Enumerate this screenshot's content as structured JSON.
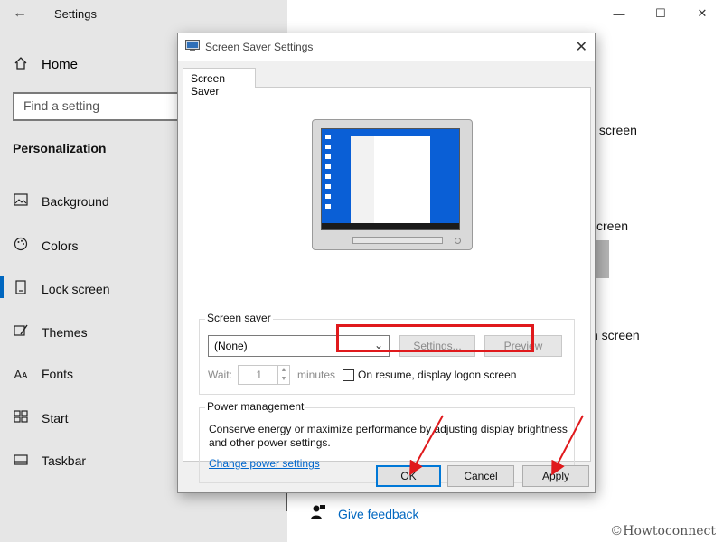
{
  "settings": {
    "title": "Settings",
    "home_label": "Home",
    "search_placeholder": "Find a setting",
    "section_title": "Personalization",
    "nav": [
      {
        "label": "Background",
        "icon": "picture-icon"
      },
      {
        "label": "Colors",
        "icon": "palette-icon"
      },
      {
        "label": "Lock screen",
        "icon": "lock-screen-icon"
      },
      {
        "label": "Themes",
        "icon": "brush-icon"
      },
      {
        "label": "Fonts",
        "icon": "font-icon"
      },
      {
        "label": "Start",
        "icon": "start-grid-icon"
      },
      {
        "label": "Taskbar",
        "icon": "taskbar-icon"
      }
    ],
    "active_item": "Lock screen",
    "background_text": [
      "k screen",
      "creen",
      "n screen"
    ],
    "feedback_label": "Give feedback"
  },
  "dialog": {
    "title": "Screen Saver Settings",
    "tab_label": "Screen Saver",
    "screen_saver_group": {
      "label": "Screen saver",
      "selected": "(None)",
      "settings_button": "Settings...",
      "preview_button": "Preview",
      "wait_label": "Wait:",
      "wait_value": "1",
      "minutes_label": "minutes",
      "resume_checkbox_label": "On resume, display logon screen",
      "resume_checked": false
    },
    "power_group": {
      "label": "Power management",
      "description": "Conserve energy or maximize performance by adjusting display brightness and other power settings.",
      "link": "Change power settings"
    },
    "buttons": {
      "ok": "OK",
      "cancel": "Cancel",
      "apply": "Apply"
    }
  },
  "watermark": "©Howtoconnect",
  "colors": {
    "accent": "#0067c0",
    "highlight": "#e0191c",
    "link": "#0066cc"
  }
}
